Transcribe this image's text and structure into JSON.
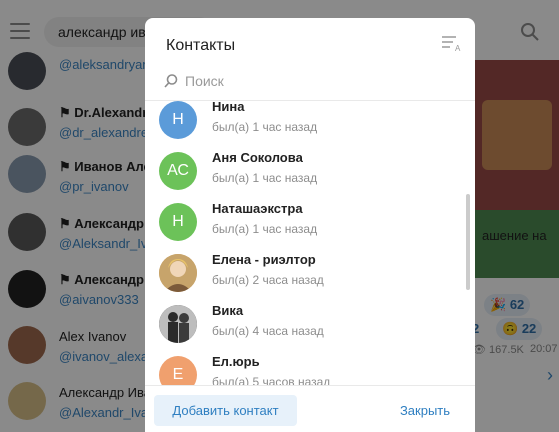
{
  "background": {
    "search_query": "александр иван",
    "chats": [
      {
        "name": "",
        "handle": "@aleksandryam"
      },
      {
        "name": "Dr.Alexandr",
        "handle": "@dr_alexandre_"
      },
      {
        "name": "Иванов Але",
        "handle": "@pr_ivanov"
      },
      {
        "name": "Александр",
        "handle": "@Aleksandr_Iva"
      },
      {
        "name": "Александр",
        "handle": "@aivanov333"
      },
      {
        "name": "Alex Ivanov",
        "handle": "@ivanov_alexan"
      },
      {
        "name": "Александр Ива",
        "handle": "@Alexandr_Ivan"
      }
    ],
    "message_fragment": "ашение на",
    "reactions": [
      "62",
      "2",
      "22"
    ],
    "views": "167.5K",
    "time": "20:07"
  },
  "dialog": {
    "title": "Контакты",
    "search_placeholder": "Поиск",
    "contacts": [
      {
        "initials": "Н",
        "name": "Нина",
        "status": "был(а) 1 час назад",
        "color": "#5b9bd9",
        "photo": false
      },
      {
        "initials": "АС",
        "name": "Аня Соколова",
        "status": "был(а) 1 час назад",
        "color": "#6cc259",
        "photo": false
      },
      {
        "initials": "Н",
        "name": "Наташаэкстра",
        "status": "был(а) 1 час назад",
        "color": "#6cc259",
        "photo": false
      },
      {
        "initials": "",
        "name": "Елена - риэлтор",
        "status": "был(а) 2 часа назад",
        "color": "#d2a35a",
        "photo": true
      },
      {
        "initials": "",
        "name": "Вика",
        "status": "был(а) 4 часа назад",
        "color": "#3a3a3a",
        "photo": true
      },
      {
        "initials": "Е",
        "name": "Ел.юрь",
        "status": "был(а) 5 часов назад",
        "color": "#f0a06e",
        "photo": false
      }
    ],
    "add_contact_label": "Добавить контакт",
    "close_label": "Закрыть"
  }
}
